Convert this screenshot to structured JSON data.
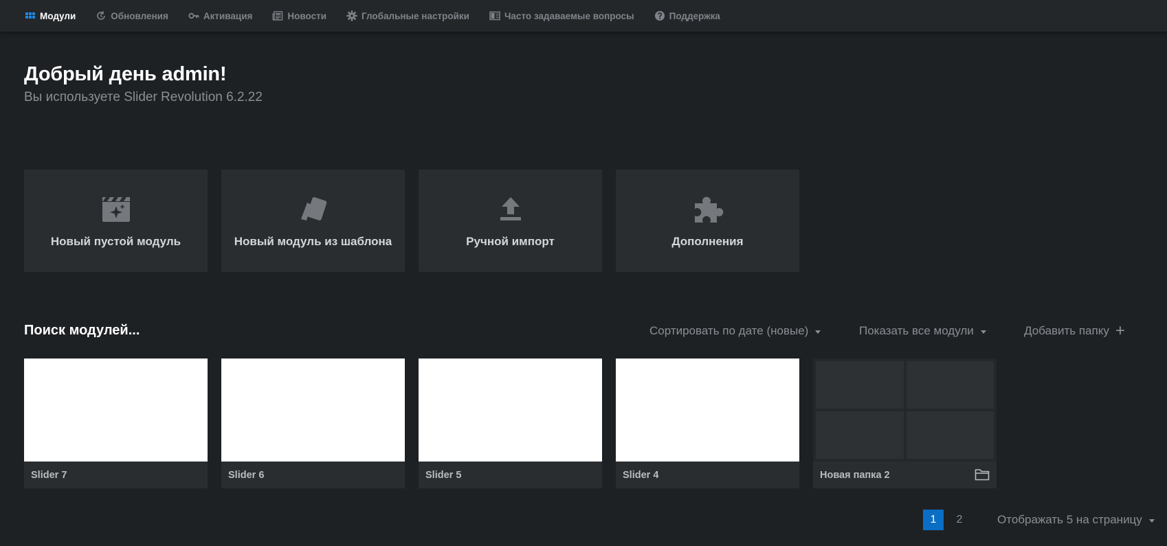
{
  "nav": {
    "items": [
      {
        "label": "Модули",
        "icon": "grid-icon",
        "active": true
      },
      {
        "label": "Обновления",
        "icon": "refresh-icon",
        "active": false
      },
      {
        "label": "Активация",
        "icon": "key-icon",
        "active": false
      },
      {
        "label": "Новости",
        "icon": "newspaper-icon",
        "active": false
      },
      {
        "label": "Глобальные настройки",
        "icon": "gear-icon",
        "active": false
      },
      {
        "label": "Часто задаваемые вопросы",
        "icon": "book-icon",
        "active": false
      },
      {
        "label": "Поддержка",
        "icon": "help-icon",
        "active": false
      }
    ],
    "accent": "#1e88e5"
  },
  "welcome": {
    "title": "Добрый день admin!",
    "subtitle": "Вы используете Slider Revolution 6.2.22"
  },
  "actions": [
    {
      "label": "Новый пустой модуль",
      "icon": "clapperboard-icon"
    },
    {
      "label": "Новый модуль из шаблона",
      "icon": "template-icon"
    },
    {
      "label": "Ручной импорт",
      "icon": "upload-icon"
    },
    {
      "label": "Дополнения",
      "icon": "puzzle-icon"
    }
  ],
  "toolbar": {
    "search_label": "Поиск модулей...",
    "sort_label": "Сортировать по дате (новые)",
    "filter_label": "Показать все модули",
    "add_folder_label": "Добавить папку"
  },
  "modules": [
    {
      "name": "Slider 7",
      "type": "slider"
    },
    {
      "name": "Slider 6",
      "type": "slider"
    },
    {
      "name": "Slider 5",
      "type": "slider"
    },
    {
      "name": "Slider 4",
      "type": "slider"
    },
    {
      "name": "Новая папка 2",
      "type": "folder"
    }
  ],
  "pagination": {
    "pages": [
      "1",
      "2"
    ],
    "current": "1",
    "per_page_label": "Отображать 5 на страницу"
  },
  "colors": {
    "background": "#1e2124",
    "card": "#2a2d30",
    "current_page": "#0b6ec4"
  }
}
